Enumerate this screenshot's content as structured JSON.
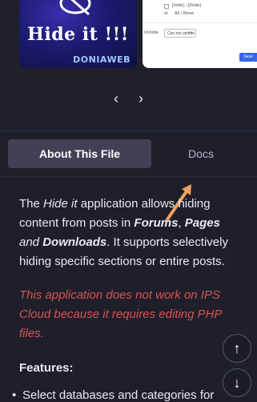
{
  "carousel": {
    "slide1": {
      "title": "Hide it !!!",
      "brand": "DONIAWEB"
    },
    "slide2": {
      "tag_text": "[hide]...[/hide]",
      "or_text": "or",
      "all_none": "All / None",
      "field_label": "Unhide",
      "select_value": "Can not unhide",
      "save_label": "Save"
    },
    "prev_icon": "chevron-left-icon",
    "next_icon": "chevron-right-icon"
  },
  "tabs": {
    "active": "About This File",
    "docs": "Docs"
  },
  "body": {
    "p1_a": "The ",
    "p1_app": "Hide it",
    "p1_b": " application allows hiding content from posts in ",
    "p1_forums": "Forums",
    "p1_c": ", ",
    "p1_pages": "Pages",
    "p1_d": " and ",
    "p1_downloads": "Downloads",
    "p1_e": ". It supports selectively hiding specific sections or entire posts.",
    "warning": "This application does not work on IPS Cloud because it requires editing PHP files.",
    "features_title": "Features:",
    "feature1": "Select databases and categories for"
  },
  "fab": {
    "up_icon": "arrow-up-icon",
    "down_icon": "arrow-down-icon"
  },
  "colors": {
    "background": "#1e1f2b",
    "active_tab": "#434056",
    "warning": "#d9534f",
    "annotation_arrow": "#f2a15f"
  }
}
